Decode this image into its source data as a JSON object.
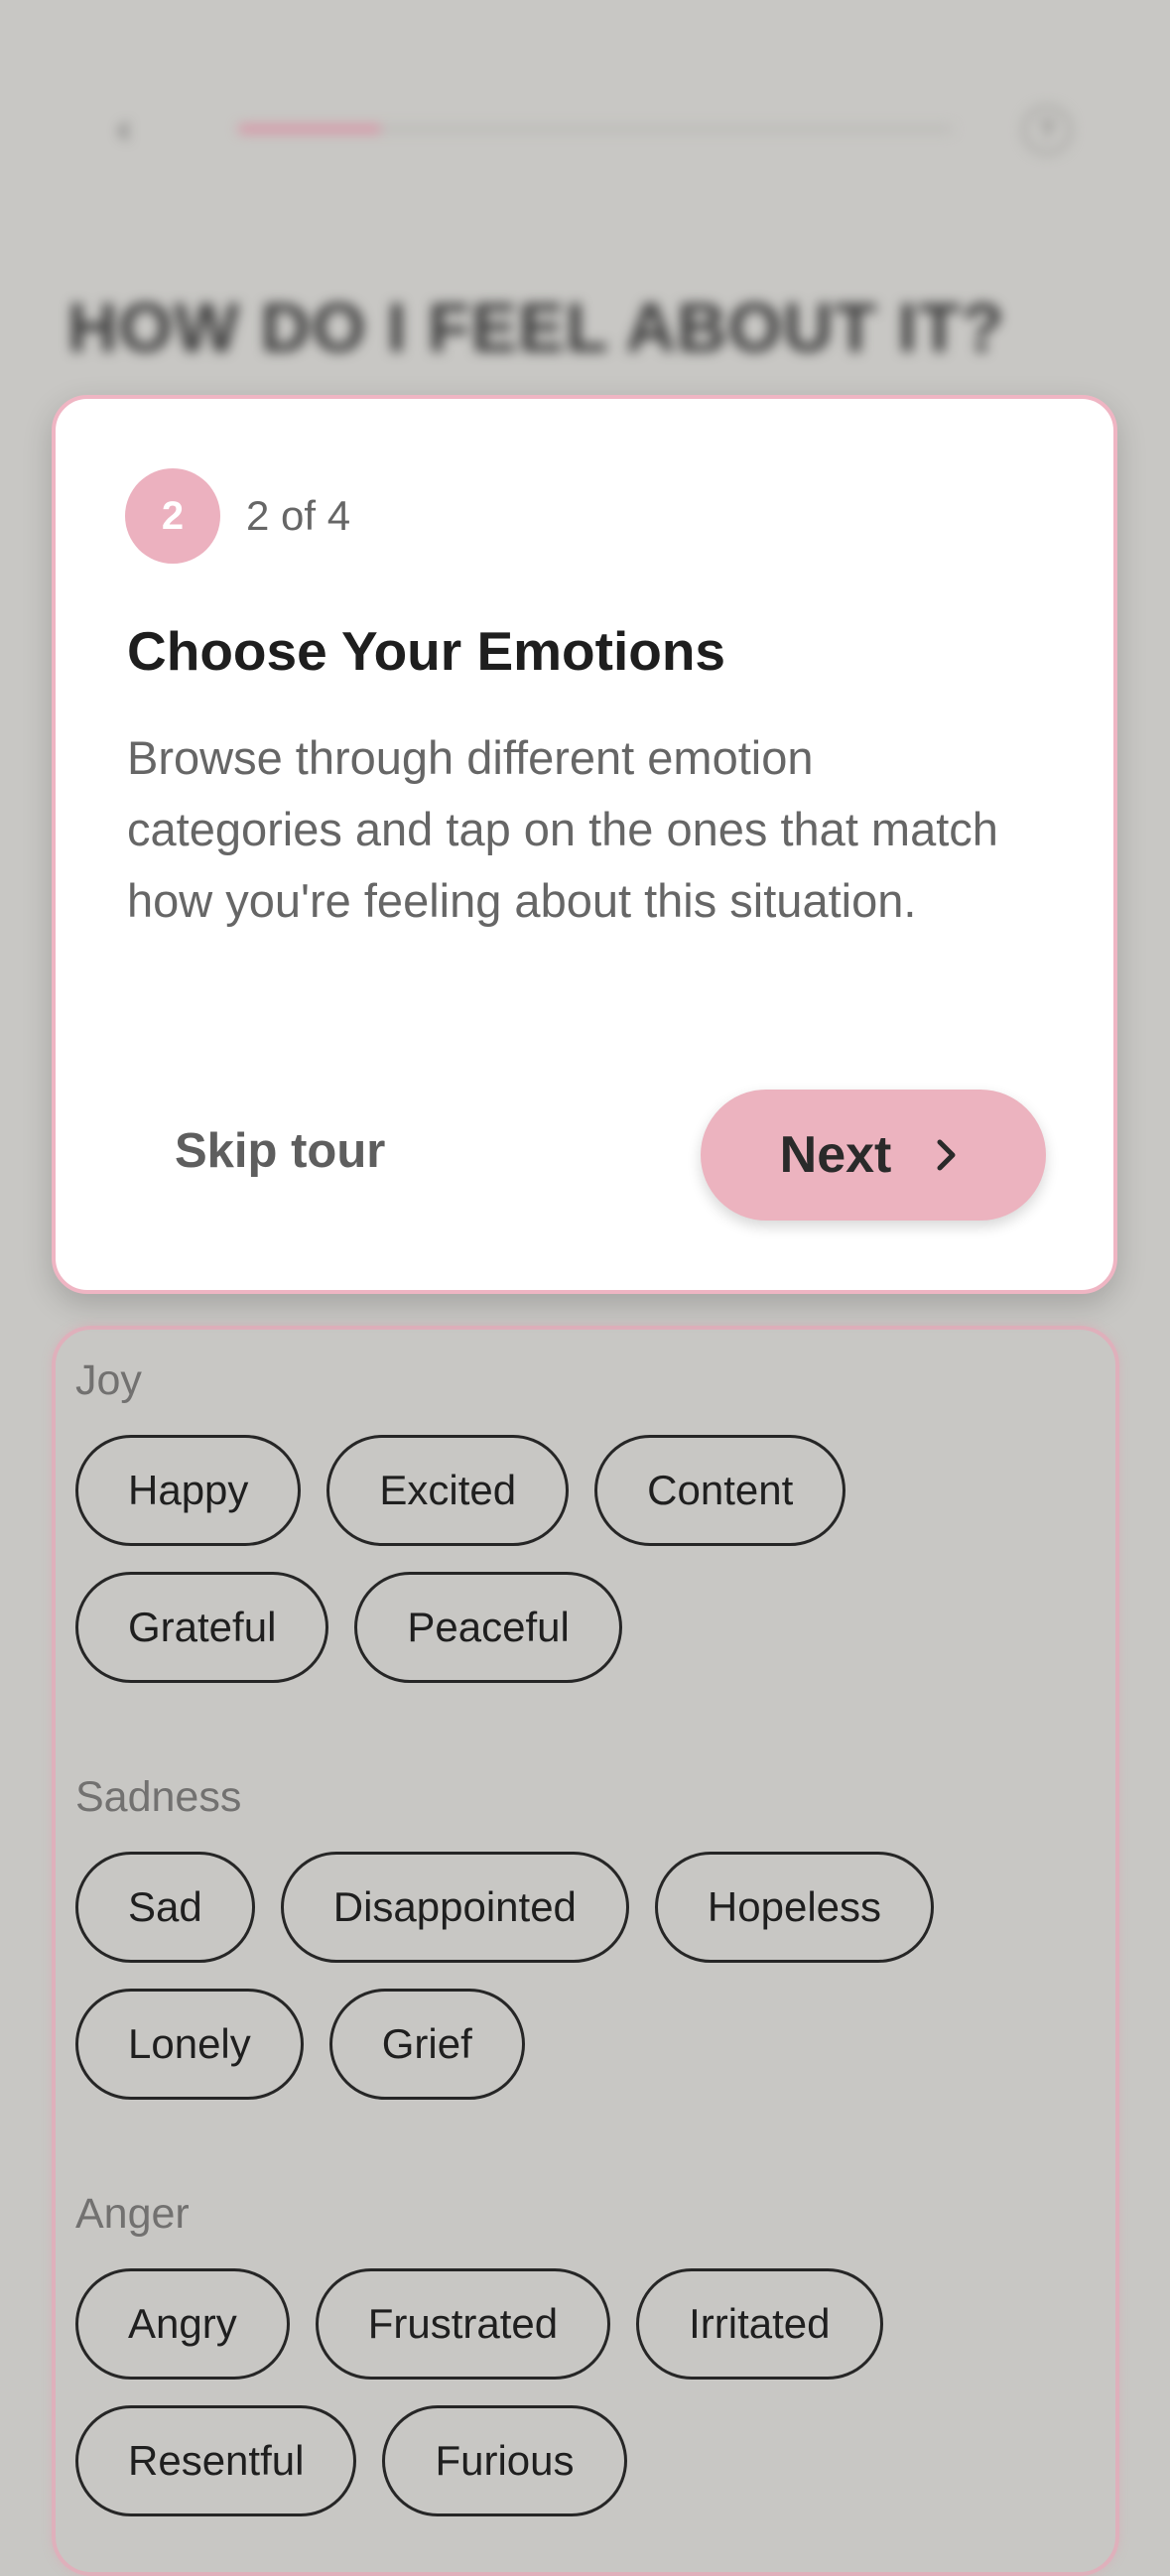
{
  "header": {
    "back_icon": "chevron-left-icon",
    "progress_fraction": 0.2,
    "help_icon": "help-circle-icon",
    "help_glyph": "?",
    "title": "HOW DO I FEEL ABOUT IT?"
  },
  "tour": {
    "step_number": "2",
    "step_count": "2 of 4",
    "title": "Choose Your Emotions",
    "body": "Browse through different emotion categories and tap on the ones that match how you're feeling about this situation.",
    "skip_label": "Skip tour",
    "next_label": "Next",
    "next_icon": "chevron-right-icon"
  },
  "categories": [
    {
      "label": "Joy",
      "rows": [
        [
          "Happy",
          "Excited",
          "Content"
        ],
        [
          "Grateful",
          "Peaceful"
        ]
      ]
    },
    {
      "label": "Sadness",
      "rows": [
        [
          "Sad",
          "Disappointed",
          "Hopeless"
        ],
        [
          "Lonely",
          "Grief"
        ]
      ]
    },
    {
      "label": "Anger",
      "rows": [
        [
          "Angry",
          "Frustrated",
          "Irritated"
        ],
        [
          "Resentful",
          "Furious"
        ]
      ]
    }
  ],
  "colors": {
    "accent_pink": "#ecb1bf",
    "overlay_gray": "#c8c7c4"
  }
}
